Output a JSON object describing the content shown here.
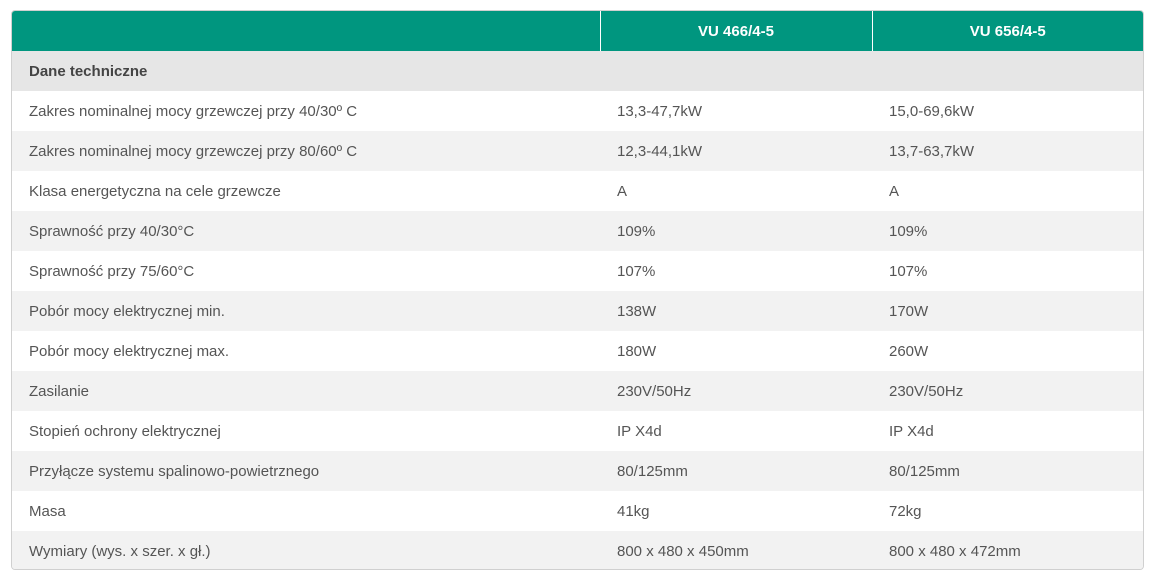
{
  "columns": [
    "",
    "VU 466/4-5",
    "VU 656/4-5"
  ],
  "section_title": "Dane techniczne",
  "rows": [
    {
      "label": "Zakres nominalnej mocy grzewczej przy 40/30º C",
      "v1": "13,3-47,7kW",
      "v2": "15,0-69,6kW"
    },
    {
      "label": "Zakres nominalnej mocy grzewczej przy 80/60º C",
      "v1": "12,3-44,1kW",
      "v2": "13,7-63,7kW"
    },
    {
      "label": "Klasa energetyczna na cele grzewcze",
      "v1": "A",
      "v2": "A"
    },
    {
      "label": "Sprawność przy 40/30°C",
      "v1": "109%",
      "v2": "109%"
    },
    {
      "label": "Sprawność przy 75/60°C",
      "v1": "107%",
      "v2": "107%"
    },
    {
      "label": "Pobór mocy elektrycznej min.",
      "v1": "138W",
      "v2": "170W"
    },
    {
      "label": "Pobór mocy elektrycznej max.",
      "v1": "180W",
      "v2": "260W"
    },
    {
      "label": "Zasilanie",
      "v1": "230V/50Hz",
      "v2": "230V/50Hz"
    },
    {
      "label": "Stopień ochrony elektrycznej",
      "v1": "IP X4d",
      "v2": "IP X4d"
    },
    {
      "label": "Przyłącze systemu spalinowo-powietrznego",
      "v1": "80/125mm",
      "v2": "80/125mm"
    },
    {
      "label": "Masa",
      "v1": "41kg",
      "v2": "72kg"
    },
    {
      "label": "Wymiary (wys. x szer. x gł.)",
      "v1": "800 x 480 x 450mm",
      "v2": "800 x 480 x 472mm"
    }
  ],
  "colors": {
    "header": "#00967f",
    "section": "#e6e6e6",
    "stripe": "#f2f2f2"
  }
}
